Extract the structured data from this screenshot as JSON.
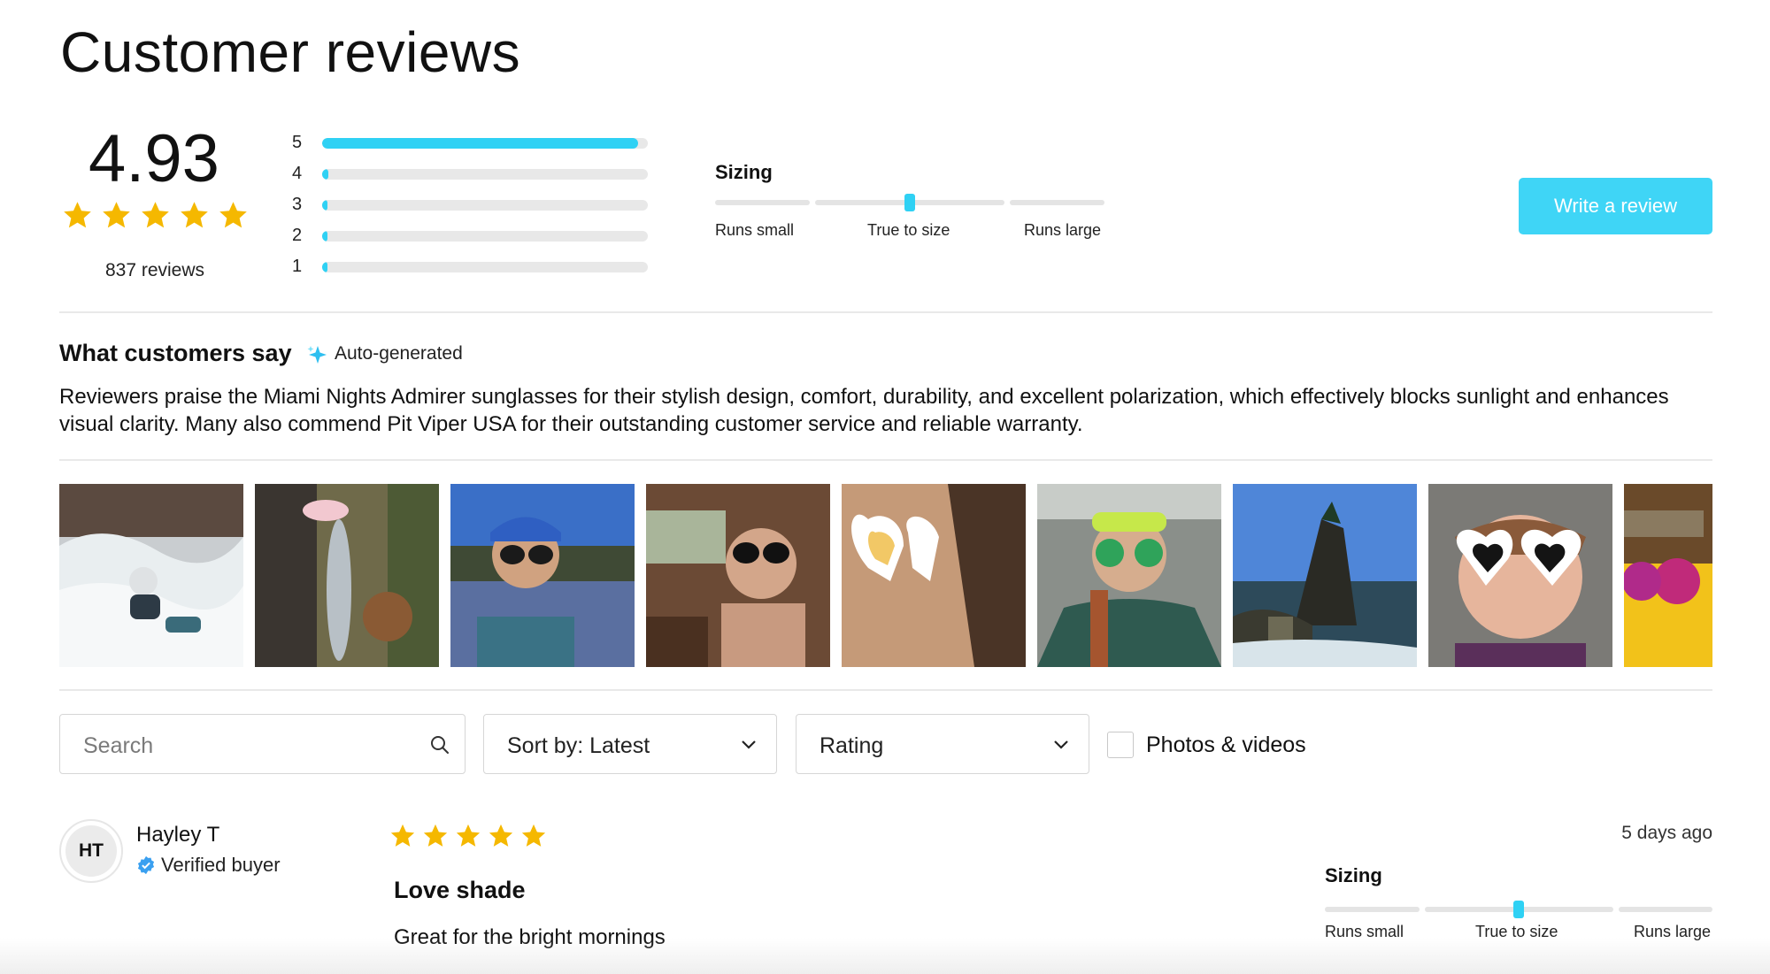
{
  "page": {
    "title": "Customer reviews"
  },
  "summary": {
    "average": "4.93",
    "rating": 4.93,
    "review_count": "837 reviews",
    "histogram": [
      {
        "label": "5",
        "fraction": 0.97
      },
      {
        "label": "4",
        "fraction": 0.02
      },
      {
        "label": "3",
        "fraction": 0.01
      },
      {
        "label": "2",
        "fraction": 0.0
      },
      {
        "label": "1",
        "fraction": 0.01
      }
    ]
  },
  "sizing": {
    "label": "Sizing",
    "options": [
      "Runs small",
      "True to size",
      "Runs large"
    ],
    "selected": "True to size"
  },
  "write_review": {
    "label": "Write a review"
  },
  "what_customers_say": {
    "title": "What customers say",
    "badge": "Auto-generated",
    "text": "Reviewers praise the Miami Nights Admirer sunglasses for their stylish design, comfort, durability, and excellent polarization, which effectively blocks sunlight and enhances visual clarity. Many also commend Pit Viper USA for their outstanding customer service and reliable warranty."
  },
  "photos": [
    {
      "name": "review-photo-river-swimmer"
    },
    {
      "name": "review-photo-fish-and-dog"
    },
    {
      "name": "review-photo-blue-cap-lake"
    },
    {
      "name": "review-photo-cabin-selfie"
    },
    {
      "name": "review-photo-heart-sunglasses-closeup"
    },
    {
      "name": "review-photo-green-sunglasses-car"
    },
    {
      "name": "review-photo-coastal-rocks"
    },
    {
      "name": "review-photo-white-heart-sunglasses"
    },
    {
      "name": "review-photo-sunglasses-on-yellow"
    }
  ],
  "filters": {
    "search_placeholder": "Search",
    "sort_label": "Sort by: Latest",
    "rating_label": "Rating",
    "photos_videos_label": "Photos & videos",
    "photos_videos_checked": false
  },
  "reviews": [
    {
      "initials": "HT",
      "name": "Hayley T",
      "verified": "Verified buyer",
      "rating": 5,
      "date": "5 days ago",
      "title": "Love shade",
      "body": "Great for the bright mornings",
      "sizing": {
        "label": "Sizing",
        "options": [
          "Runs small",
          "True to size",
          "Runs large"
        ],
        "selected": "True to size"
      }
    }
  ],
  "colors": {
    "accent": "#2fd1f4",
    "button": "#3fd5f6",
    "star": "#f5b800",
    "verified": "#3aa0f0"
  },
  "icons": [
    "star-icon",
    "sparkle-icon",
    "search-icon",
    "chevron-down-icon",
    "verified-check-icon"
  ]
}
